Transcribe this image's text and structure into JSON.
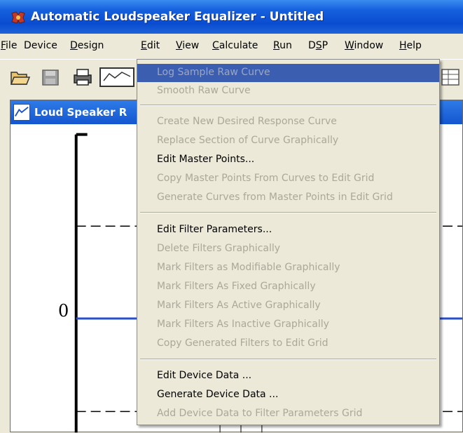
{
  "window": {
    "title": "Automatic Loudspeaker Equalizer - Untitled"
  },
  "menubar": [
    {
      "label": "File",
      "accel": "F",
      "rest": "ile"
    },
    {
      "label": "Device",
      "accel": "",
      "rest": "Device"
    },
    {
      "label": "Design",
      "accel": "D",
      "rest": "esign"
    },
    {
      "label": "Edit",
      "accel": "E",
      "rest": "dit"
    },
    {
      "label": "View",
      "accel": "V",
      "rest": "iew"
    },
    {
      "label": "Calculate",
      "accel": "C",
      "rest": "alculate"
    },
    {
      "label": "Run",
      "accel": "R",
      "rest": "un"
    },
    {
      "label": "DSP",
      "pre": "D",
      "accel": "S",
      "rest": "P"
    },
    {
      "label": "Window",
      "accel": "W",
      "rest": "indow"
    },
    {
      "label": "Help",
      "accel": "H",
      "rest": "elp"
    }
  ],
  "child_window": {
    "title": "Loud Speaker R"
  },
  "plot": {
    "y_tick_label": "0",
    "accent": "#2B4FC8"
  },
  "edit_menu": {
    "items": [
      {
        "label": "Log Sample Raw Curve",
        "state": "highlighted"
      },
      {
        "label": "Smooth Raw Curve",
        "state": "disabled"
      },
      {
        "label": "Create New Desired Response Curve",
        "state": "disabled"
      },
      {
        "label": "Replace Section of Curve Graphically",
        "state": "disabled"
      },
      {
        "label": "Edit Master Points...",
        "state": "enabled"
      },
      {
        "label": "Copy Master Points From Curves to Edit Grid",
        "state": "disabled"
      },
      {
        "label": "Generate Curves from Master Points in Edit Grid",
        "state": "disabled"
      },
      {
        "label": "Edit Filter Parameters...",
        "state": "enabled"
      },
      {
        "label": "Delete Filters Graphically",
        "state": "disabled"
      },
      {
        "label": "Mark Filters as Modifiable Graphically",
        "state": "disabled"
      },
      {
        "label": "Mark Filters As Fixed Graphically",
        "state": "disabled"
      },
      {
        "label": "Mark Filters As Active Graphically",
        "state": "disabled"
      },
      {
        "label": "Mark Filters As Inactive Graphically",
        "state": "disabled"
      },
      {
        "label": "Copy Generated Filters to Edit Grid",
        "state": "disabled"
      },
      {
        "label": "Edit Device Data ...",
        "state": "enabled"
      },
      {
        "label": "Generate Device Data ...",
        "state": "enabled"
      },
      {
        "label": "Add Device Data to Filter Parameters Grid",
        "state": "disabled"
      }
    ]
  }
}
